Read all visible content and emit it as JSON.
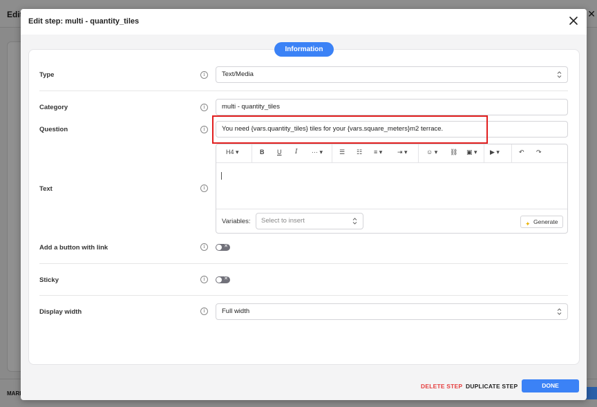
{
  "background": {
    "title": "Edit",
    "footer_label": "MARK"
  },
  "modal": {
    "title": "Edit step: multi - quantity_tiles",
    "tab": "Information"
  },
  "fields": {
    "type": {
      "label": "Type",
      "value": "Text/Media"
    },
    "category": {
      "label": "Category",
      "value": "multi - quantity_tiles"
    },
    "question": {
      "label": "Question",
      "value": "You need {vars.quantity_tiles} tiles for your {vars.square_meters}m2 terrace."
    },
    "text": {
      "label": "Text"
    },
    "add_button": {
      "label": "Add a button with link",
      "enabled": false
    },
    "sticky": {
      "label": "Sticky",
      "enabled": false
    },
    "display_width": {
      "label": "Display width",
      "value": "Full width"
    }
  },
  "editor": {
    "heading_select": "H4",
    "variables_label": "Variables:",
    "variables_placeholder": "Select to insert",
    "generate_label": "Generate"
  },
  "footer": {
    "delete": "DELETE STEP",
    "duplicate": "DUPLICATE STEP",
    "done": "DONE"
  },
  "colors": {
    "accent": "#3b82f6",
    "danger": "#e53e3e",
    "highlight": "#e11d1d"
  }
}
